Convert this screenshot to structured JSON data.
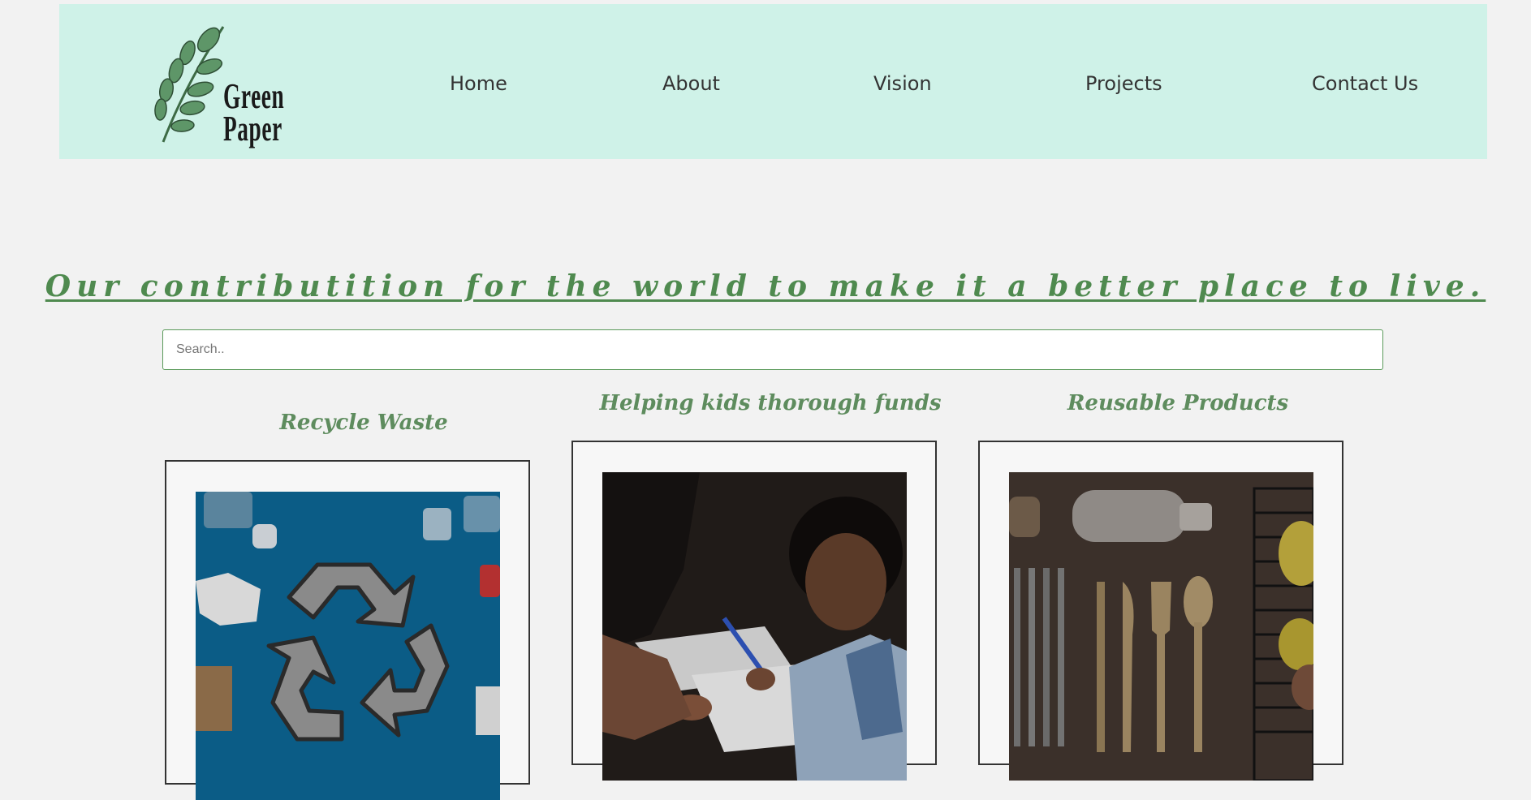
{
  "brand": {
    "line1": "Green",
    "line2": "Paper"
  },
  "nav": {
    "items": [
      "Home",
      "About",
      "Vision",
      "Projects",
      "Contact Us"
    ]
  },
  "hero": {
    "headline": "Our contributition for the world to make it a better place to live."
  },
  "search": {
    "placeholder": "Search.."
  },
  "cards": [
    {
      "title": "Recycle Waste",
      "image": "recycle-symbol-image"
    },
    {
      "title": "Helping kids thorough funds",
      "image": "kids-drawing-image"
    },
    {
      "title": "Reusable Products",
      "image": "reusable-utensils-image"
    }
  ],
  "colors": {
    "header_bg": "#cff2e8",
    "accent_green": "#4f8a4f",
    "page_bg": "#f2f2f2"
  }
}
